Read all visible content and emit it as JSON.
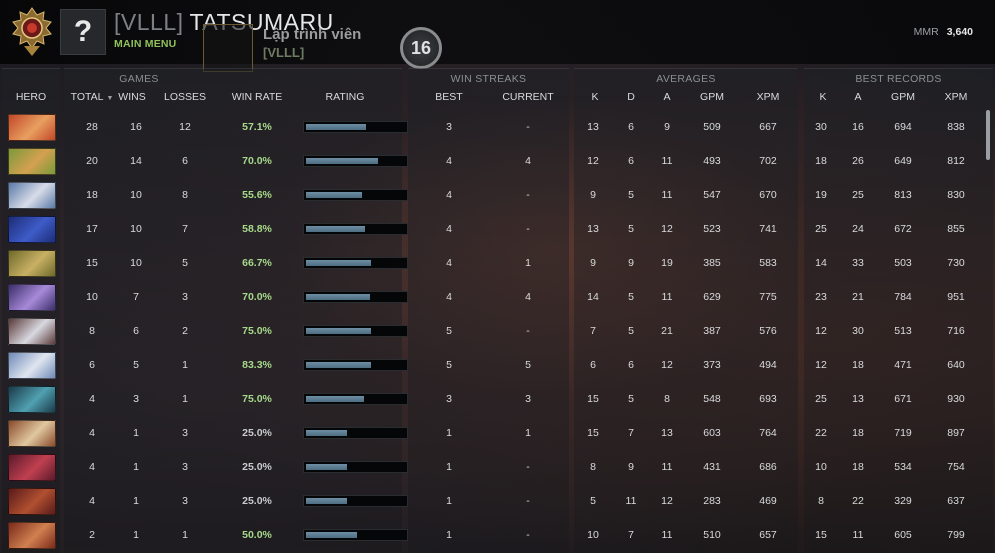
{
  "header": {
    "player_tag": "[VLLL]",
    "player_name": "TATSUMARU",
    "main_menu": "MAIN MENU",
    "avatar_glyph": "?",
    "guild_name": "Lập trình viên",
    "guild_tag": "[VLLL]",
    "level": "16",
    "mmr_label": "MMR",
    "mmr_value": "3,640"
  },
  "groups": {
    "games": "GAMES",
    "win_streaks": "WIN STREAKS",
    "averages": "AVERAGES",
    "best_records": "BEST RECORDS"
  },
  "columns": {
    "hero": "HERO",
    "total": "TOTAL",
    "wins": "WINS",
    "losses": "LOSSES",
    "win_rate": "WIN RATE",
    "rating": "RATING",
    "best": "BEST",
    "current": "CURRENT",
    "avg_k": "K",
    "avg_d": "D",
    "avg_a": "A",
    "avg_gpm": "GPM",
    "avg_xpm": "XPM",
    "best_k": "K",
    "best_a": "A",
    "best_gpm": "GPM",
    "best_xpm": "XPM"
  },
  "colors": {
    "win_good": "#a6d98a",
    "win_bad": "#c9cbcd",
    "accent_green": "#8fc25a",
    "rating_fill": "#5b7d92"
  },
  "rows": [
    {
      "hero_icon": "hero-lina-icon",
      "hero_colors": [
        "#c2462a",
        "#e8a060"
      ],
      "total": "28",
      "wins": "16",
      "losses": "12",
      "win_rate": "57.1%",
      "rating": 0.59,
      "best": "3",
      "current": "-",
      "k": "13",
      "d": "6",
      "a": "9",
      "gpm": "509",
      "xpm": "667",
      "bk": "30",
      "ba": "16",
      "bgpm": "694",
      "bxpm": "838"
    },
    {
      "hero_icon": "hero-windranger-icon",
      "hero_colors": [
        "#7a9a3a",
        "#d4a050"
      ],
      "total": "20",
      "wins": "14",
      "losses": "6",
      "win_rate": "70.0%",
      "rating": 0.71,
      "best": "4",
      "current": "4",
      "k": "12",
      "d": "6",
      "a": "11",
      "gpm": "493",
      "xpm": "702",
      "bk": "18",
      "ba": "26",
      "bgpm": "649",
      "bxpm": "812"
    },
    {
      "hero_icon": "hero-crystal-maiden-icon",
      "hero_colors": [
        "#5a7aa8",
        "#d8dce8"
      ],
      "total": "18",
      "wins": "10",
      "losses": "8",
      "win_rate": "55.6%",
      "rating": 0.55,
      "best": "4",
      "current": "-",
      "k": "9",
      "d": "5",
      "a": "11",
      "gpm": "547",
      "xpm": "670",
      "bk": "19",
      "ba": "25",
      "bgpm": "813",
      "bxpm": "830"
    },
    {
      "hero_icon": "hero-night-stalker-icon",
      "hero_colors": [
        "#1c2c78",
        "#3e5cc8"
      ],
      "total": "17",
      "wins": "10",
      "losses": "7",
      "win_rate": "58.8%",
      "rating": 0.58,
      "best": "4",
      "current": "-",
      "k": "13",
      "d": "5",
      "a": "12",
      "gpm": "523",
      "xpm": "741",
      "bk": "25",
      "ba": "24",
      "bgpm": "672",
      "bxpm": "855"
    },
    {
      "hero_icon": "hero-sand-king-icon",
      "hero_colors": [
        "#6e6a2a",
        "#c8b064"
      ],
      "total": "15",
      "wins": "10",
      "losses": "5",
      "win_rate": "66.7%",
      "rating": 0.64,
      "best": "4",
      "current": "1",
      "k": "9",
      "d": "9",
      "a": "19",
      "gpm": "385",
      "xpm": "583",
      "bk": "14",
      "ba": "33",
      "bgpm": "503",
      "bxpm": "730"
    },
    {
      "hero_icon": "hero-bane-icon",
      "hero_colors": [
        "#3a2e6a",
        "#a88ad8"
      ],
      "total": "10",
      "wins": "7",
      "losses": "3",
      "win_rate": "70.0%",
      "rating": 0.63,
      "best": "4",
      "current": "4",
      "k": "14",
      "d": "5",
      "a": "11",
      "gpm": "629",
      "xpm": "775",
      "bk": "23",
      "ba": "21",
      "bgpm": "784",
      "bxpm": "951"
    },
    {
      "hero_icon": "hero-omniknight-icon",
      "hero_colors": [
        "#5a3a3a",
        "#d8d8e0"
      ],
      "total": "8",
      "wins": "6",
      "losses": "2",
      "win_rate": "75.0%",
      "rating": 0.64,
      "best": "5",
      "current": "-",
      "k": "7",
      "d": "5",
      "a": "21",
      "gpm": "387",
      "xpm": "576",
      "bk": "12",
      "ba": "30",
      "bgpm": "513",
      "bxpm": "716"
    },
    {
      "hero_icon": "hero-rylai-icon",
      "hero_colors": [
        "#6e8ab8",
        "#e0e6f0"
      ],
      "total": "6",
      "wins": "5",
      "losses": "1",
      "win_rate": "83.3%",
      "rating": 0.64,
      "best": "5",
      "current": "5",
      "k": "6",
      "d": "6",
      "a": "12",
      "gpm": "373",
      "xpm": "494",
      "bk": "12",
      "ba": "18",
      "bgpm": "471",
      "bxpm": "640"
    },
    {
      "hero_icon": "hero-phantom-assassin-icon",
      "hero_colors": [
        "#1a3a4a",
        "#50a0b0"
      ],
      "total": "4",
      "wins": "3",
      "losses": "1",
      "win_rate": "75.0%",
      "rating": 0.57,
      "best": "3",
      "current": "3",
      "k": "15",
      "d": "5",
      "a": "8",
      "gpm": "548",
      "xpm": "693",
      "bk": "25",
      "ba": "13",
      "bgpm": "671",
      "bxpm": "930"
    },
    {
      "hero_icon": "hero-juggernaut-icon",
      "hero_colors": [
        "#8a4a2a",
        "#e0c8a0"
      ],
      "total": "4",
      "wins": "1",
      "losses": "3",
      "win_rate": "25.0%",
      "rating": 0.41,
      "best": "1",
      "current": "1",
      "k": "15",
      "d": "7",
      "a": "13",
      "gpm": "603",
      "xpm": "764",
      "bk": "22",
      "ba": "18",
      "bgpm": "719",
      "bxpm": "897"
    },
    {
      "hero_icon": "hero-queen-of-pain-icon",
      "hero_colors": [
        "#5a1a2a",
        "#c04050"
      ],
      "total": "4",
      "wins": "1",
      "losses": "3",
      "win_rate": "25.0%",
      "rating": 0.41,
      "best": "1",
      "current": "-",
      "k": "8",
      "d": "9",
      "a": "11",
      "gpm": "431",
      "xpm": "686",
      "bk": "10",
      "ba": "18",
      "bgpm": "534",
      "bxpm": "754"
    },
    {
      "hero_icon": "hero-shadow-demon-icon",
      "hero_colors": [
        "#5a1a1a",
        "#b05030"
      ],
      "total": "4",
      "wins": "1",
      "losses": "3",
      "win_rate": "25.0%",
      "rating": 0.41,
      "best": "1",
      "current": "-",
      "k": "5",
      "d": "11",
      "a": "12",
      "gpm": "283",
      "xpm": "469",
      "bk": "8",
      "ba": "22",
      "bgpm": "329",
      "bxpm": "637"
    },
    {
      "hero_icon": "hero-axe-icon",
      "hero_colors": [
        "#7a2a1a",
        "#d08050"
      ],
      "total": "2",
      "wins": "1",
      "losses": "1",
      "win_rate": "50.0%",
      "rating": 0.5,
      "best": "1",
      "current": "-",
      "k": "10",
      "d": "7",
      "a": "11",
      "gpm": "510",
      "xpm": "657",
      "bk": "15",
      "ba": "11",
      "bgpm": "605",
      "bxpm": "799"
    }
  ]
}
